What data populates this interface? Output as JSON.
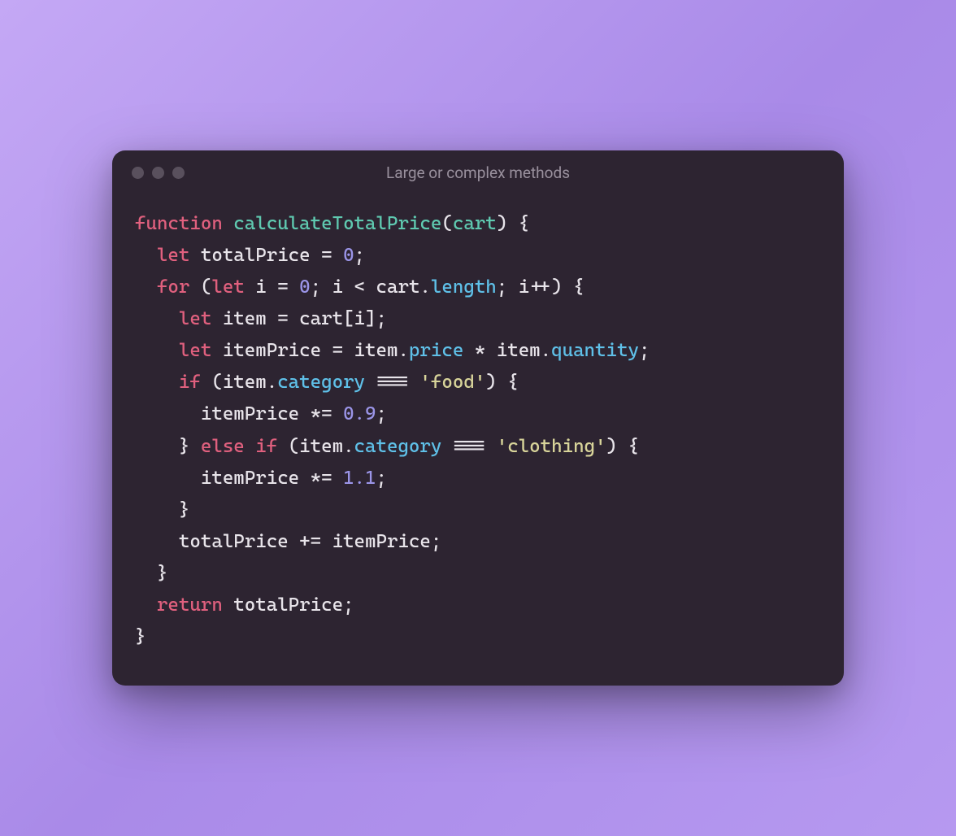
{
  "window": {
    "title": "Large or complex methods"
  },
  "code": {
    "lines": [
      [
        {
          "t": "function",
          "c": "keyword"
        },
        {
          "t": " ",
          "c": "punct"
        },
        {
          "t": "calculateTotalPrice",
          "c": "funcname"
        },
        {
          "t": "(",
          "c": "punct"
        },
        {
          "t": "cart",
          "c": "param"
        },
        {
          "t": ") {",
          "c": "punct"
        }
      ],
      [
        {
          "t": "  ",
          "c": "punct"
        },
        {
          "t": "let",
          "c": "keyword"
        },
        {
          "t": " totalPrice = ",
          "c": "ident"
        },
        {
          "t": "0",
          "c": "number"
        },
        {
          "t": ";",
          "c": "punct"
        }
      ],
      [
        {
          "t": "  ",
          "c": "punct"
        },
        {
          "t": "for",
          "c": "keyword"
        },
        {
          "t": " (",
          "c": "punct"
        },
        {
          "t": "let",
          "c": "keyword"
        },
        {
          "t": " i = ",
          "c": "ident"
        },
        {
          "t": "0",
          "c": "number"
        },
        {
          "t": "; i < cart.",
          "c": "ident"
        },
        {
          "t": "length",
          "c": "property"
        },
        {
          "t": "; i++) {",
          "c": "punct"
        }
      ],
      [
        {
          "t": "    ",
          "c": "punct"
        },
        {
          "t": "let",
          "c": "keyword"
        },
        {
          "t": " item = cart[i];",
          "c": "ident"
        }
      ],
      [
        {
          "t": "    ",
          "c": "punct"
        },
        {
          "t": "let",
          "c": "keyword"
        },
        {
          "t": " itemPrice = item.",
          "c": "ident"
        },
        {
          "t": "price",
          "c": "property"
        },
        {
          "t": " * item.",
          "c": "ident"
        },
        {
          "t": "quantity",
          "c": "property"
        },
        {
          "t": ";",
          "c": "punct"
        }
      ],
      [
        {
          "t": "    ",
          "c": "punct"
        },
        {
          "t": "if",
          "c": "keyword"
        },
        {
          "t": " (item.",
          "c": "ident"
        },
        {
          "t": "category",
          "c": "property"
        },
        {
          "t": " === ",
          "c": "ident"
        },
        {
          "t": "'food'",
          "c": "string"
        },
        {
          "t": ") {",
          "c": "punct"
        }
      ],
      [
        {
          "t": "      itemPrice *= ",
          "c": "ident"
        },
        {
          "t": "0.9",
          "c": "number"
        },
        {
          "t": ";",
          "c": "punct"
        }
      ],
      [
        {
          "t": "    } ",
          "c": "punct"
        },
        {
          "t": "else",
          "c": "keyword"
        },
        {
          "t": " ",
          "c": "punct"
        },
        {
          "t": "if",
          "c": "keyword"
        },
        {
          "t": " (item.",
          "c": "ident"
        },
        {
          "t": "category",
          "c": "property"
        },
        {
          "t": " === ",
          "c": "ident"
        },
        {
          "t": "'clothing'",
          "c": "string"
        },
        {
          "t": ") {",
          "c": "punct"
        }
      ],
      [
        {
          "t": "      itemPrice *= ",
          "c": "ident"
        },
        {
          "t": "1.1",
          "c": "number"
        },
        {
          "t": ";",
          "c": "punct"
        }
      ],
      [
        {
          "t": "    }",
          "c": "punct"
        }
      ],
      [
        {
          "t": "    totalPrice += itemPrice;",
          "c": "ident"
        }
      ],
      [
        {
          "t": "  }",
          "c": "punct"
        }
      ],
      [
        {
          "t": "  ",
          "c": "punct"
        },
        {
          "t": "return",
          "c": "keyword"
        },
        {
          "t": " totalPrice;",
          "c": "ident"
        }
      ],
      [
        {
          "t": "}",
          "c": "punct"
        }
      ]
    ]
  },
  "colors": {
    "background_gradient_start": "#c4a8f5",
    "background_gradient_end": "#b699f0",
    "window_bg": "#2d2431",
    "traffic_light": "#59505d",
    "title_text": "#9a919e",
    "code_default": "#e8e4ea",
    "code_keyword": "#e0607e",
    "code_function": "#5fc9b0",
    "code_number": "#9b95e8",
    "code_property": "#5fc0e8",
    "code_string": "#d8d49a"
  }
}
